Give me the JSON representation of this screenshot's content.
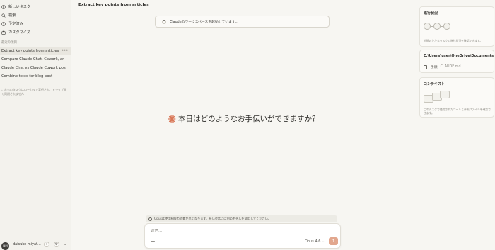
{
  "sidebar": {
    "items": [
      {
        "label": "新しいタスク",
        "icon": "plus-circle-icon"
      },
      {
        "label": "検索",
        "icon": "search-icon"
      },
      {
        "label": "予定済み",
        "icon": "clock-icon"
      },
      {
        "label": "カスタマイズ",
        "icon": "briefcase-icon"
      }
    ],
    "section_label": "最近の項目",
    "tasks": [
      {
        "label": "Extract key points from articles",
        "active": true
      },
      {
        "label": "Compare Claude Chat, Cowork, an",
        "active": false
      },
      {
        "label": "Claude Chat vs Claude Cowork pos",
        "active": false
      },
      {
        "label": "Combine texts for blog post",
        "active": false
      }
    ],
    "more_label": "•••",
    "note": "これらのタスクはローカルで実行され、ドライブ間で同期されません",
    "user": {
      "avatar": "DM",
      "name": "daisuke miyat..."
    }
  },
  "header": {
    "title": "Extract key points from articles"
  },
  "status_banner": {
    "text": "Claudeのワークスペースを起動しています..."
  },
  "greeting": "本日はどのようなお手伝いができますか？",
  "notice": "Opusは使用制限の消費が早くなります。長い会話には別のモデルを試用してください。",
  "composer": {
    "placeholder": "返信...",
    "model": "Opus 4.6 ⌄",
    "send": "↑",
    "add": "+"
  },
  "progress_panel": {
    "title": "進行状況",
    "note": "時間のかかるタスクの進捗状況を確認できます。"
  },
  "folder_panel": {
    "title": "C:\\Users\\user\\OneDrive\\Documents\\cow",
    "file_label": "手順",
    "file_name": "CLAUDE.md"
  },
  "context_panel": {
    "title": "コンテキスト",
    "note": "このタスクで使用されたツールと参照ファイルを確認できます。"
  },
  "colors": {
    "accent": "#d97757",
    "send": "#e2a78e"
  }
}
